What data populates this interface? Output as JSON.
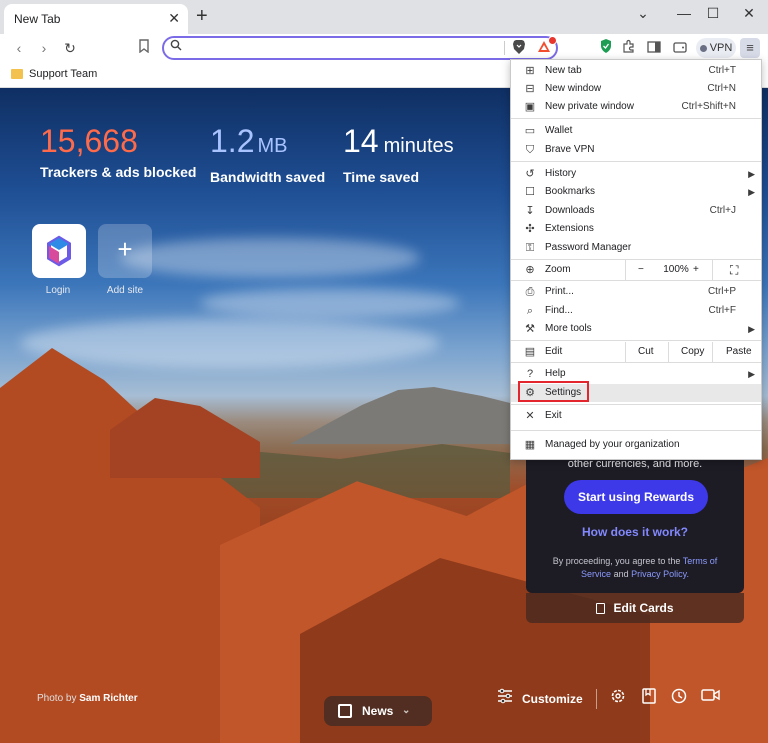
{
  "browser": {
    "tab_title": "New Tab",
    "tab_close": "✕",
    "new_tab_glyph": "+",
    "window_controls": [
      "⌄",
      "—",
      "☐",
      "✕"
    ]
  },
  "toolbar": {
    "address_placeholder": "",
    "vpn_label": "VPN",
    "accent_color": "#7b6be6"
  },
  "bookmarks": {
    "items": [
      {
        "label": "Support Team",
        "icon": "folder-icon"
      }
    ]
  },
  "newtab": {
    "stats": [
      {
        "value": "15,668",
        "unit": "",
        "label": "Trackers & ads blocked",
        "color": "#ff6b4a"
      },
      {
        "value": "1.2",
        "unit": "MB",
        "label": "Bandwidth saved",
        "color": "#a9c3ff"
      },
      {
        "value": "14",
        "unit": "minutes",
        "label": "Time saved",
        "color": "#ffffff"
      }
    ],
    "tiles": [
      {
        "label": "Login",
        "icon": "microsoft-365-icon"
      },
      {
        "label": "Add site",
        "icon": "plus-icon"
      }
    ],
    "rewards": {
      "currencies_text": "other currencies, and more.",
      "start_button": "Start using Rewards",
      "how_link": "How does it work?",
      "terms_prefix": "By proceeding, you agree to the",
      "terms_link": "Terms of Service",
      "terms_and": "and",
      "privacy_link": "Privacy Policy."
    },
    "edit_cards": "Edit Cards",
    "photo_credit_prefix": "Photo by",
    "photo_credit_author": "Sam Richter",
    "news_label": "News",
    "customize_label": "Customize"
  },
  "menu": {
    "items": [
      {
        "label": "New tab",
        "shortcut": "Ctrl+T",
        "icon": "new-tab-icon"
      },
      {
        "label": "New window",
        "shortcut": "Ctrl+N",
        "icon": "new-window-icon"
      },
      {
        "label": "New private window",
        "shortcut": "Ctrl+Shift+N",
        "icon": "private-window-icon"
      },
      {
        "label": "Wallet",
        "shortcut": "",
        "icon": "wallet-icon"
      },
      {
        "label": "Brave VPN",
        "shortcut": "",
        "icon": "vpn-shield-icon"
      },
      {
        "label": "History",
        "shortcut": "",
        "icon": "history-icon",
        "submenu": true
      },
      {
        "label": "Bookmarks",
        "shortcut": "",
        "icon": "bookmarks-icon",
        "submenu": true
      },
      {
        "label": "Downloads",
        "shortcut": "Ctrl+J",
        "icon": "downloads-icon"
      },
      {
        "label": "Extensions",
        "shortcut": "",
        "icon": "extensions-icon"
      },
      {
        "label": "Password Manager",
        "shortcut": "",
        "icon": "key-icon"
      },
      {
        "label": "Zoom",
        "icon": "zoom-icon"
      },
      {
        "label": "Print...",
        "shortcut": "Ctrl+P",
        "icon": "print-icon"
      },
      {
        "label": "Find...",
        "shortcut": "Ctrl+F",
        "icon": "find-icon"
      },
      {
        "label": "More tools",
        "shortcut": "",
        "icon": "more-tools-icon",
        "submenu": true
      },
      {
        "label": "Edit",
        "icon": "edit-icon"
      },
      {
        "label": "Help",
        "shortcut": "",
        "icon": "help-icon",
        "submenu": true
      },
      {
        "label": "Settings",
        "shortcut": "",
        "icon": "gear-icon"
      },
      {
        "label": "Exit",
        "shortcut": "",
        "icon": "exit-icon"
      },
      {
        "label": "Managed by your organization",
        "shortcut": "",
        "icon": "building-icon"
      }
    ],
    "zoom": {
      "minus": "−",
      "level": "100%",
      "plus": "+",
      "fullscreen": "⛶"
    },
    "edit": {
      "cut": "Cut",
      "copy": "Copy",
      "paste": "Paste"
    },
    "highlight_color": "#e3262e"
  }
}
